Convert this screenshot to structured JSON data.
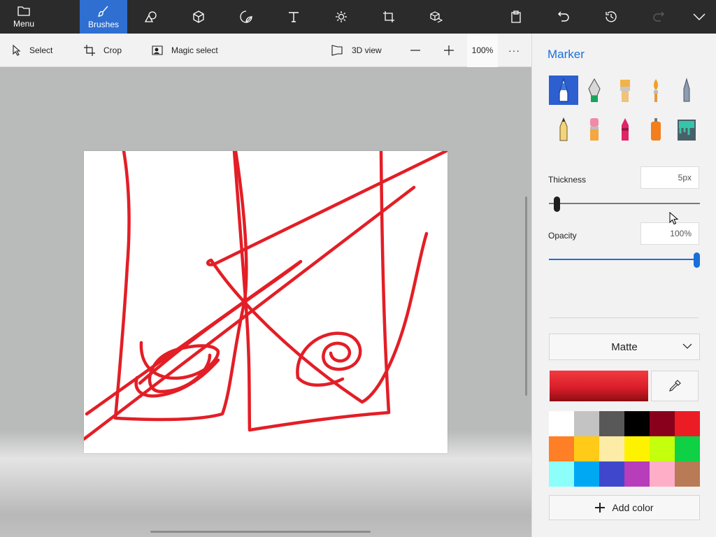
{
  "topbar": {
    "menu_label": "Menu",
    "brushes_label": "Brushes",
    "icons": [
      "folder-icon",
      "brush-icon",
      "2d-shapes-icon",
      "3d-shapes-icon",
      "stickers-icon",
      "text-icon",
      "effects-icon",
      "canvas-icon",
      "3d-library-icon",
      "paste-icon",
      "undo-icon",
      "history-icon",
      "redo-icon",
      "expand-icon"
    ]
  },
  "subbar": {
    "select_label": "Select",
    "crop_label": "Crop",
    "magic_select_label": "Magic select",
    "view3d_label": "3D view",
    "zoom_value": "100%",
    "more_label": "···"
  },
  "panel": {
    "title": "Marker",
    "brushes": [
      "marker",
      "calligraphy-pen",
      "oil-brush",
      "watercolor",
      "pixel-pen",
      "pencil",
      "eraser",
      "crayon",
      "spray-can",
      "fill"
    ],
    "selected_brush": "marker",
    "thickness_label": "Thickness",
    "thickness_value": "5px",
    "thickness_level": 0.06,
    "opacity_label": "Opacity",
    "opacity_value": "100%",
    "opacity_level": 1.0,
    "finish_label": "Matte",
    "current_color": "#e0202b",
    "add_color_label": "Add color",
    "swatches": [
      "#ffffff",
      "#c3c3c3",
      "#585858",
      "#000000",
      "#88001b",
      "#ec1c24",
      "#ff7f27",
      "#ffca18",
      "#fdeca6",
      "#fff200",
      "#c4ff0e",
      "#0ed145",
      "#8cfffb",
      "#00a8f3",
      "#3f48cc",
      "#b83dba",
      "#ffaec8",
      "#b97a56"
    ]
  },
  "colors": {
    "accent": "#2f6fd1",
    "topbar_bg": "#2b2b2b",
    "stroke": "#e31e26"
  }
}
